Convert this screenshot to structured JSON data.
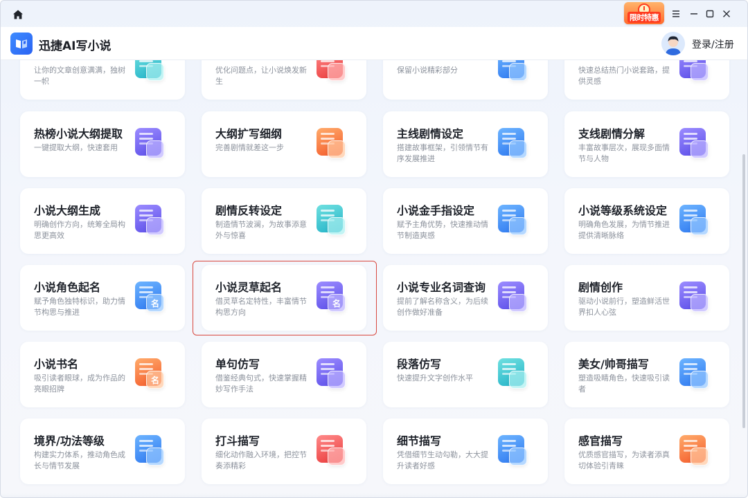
{
  "titlebar": {
    "promo_label": "限时特惠",
    "menu_icon": "hamburger-icon",
    "minimize_icon": "minimize-icon",
    "maximize_icon": "maximize-icon",
    "close_icon": "close-icon"
  },
  "header": {
    "app_title": "迅捷AI写小说",
    "login_label": "登录/注册"
  },
  "colors": {
    "blue": "#2d78f0",
    "purple": "#5a4de8",
    "orange": "#f45a2a",
    "teal": "#23b3c8",
    "red": "#ea3a3a",
    "highlight_border": "#d8473e"
  },
  "cards": [
    {
      "title": "",
      "desc": "让你的文章创意满满，独树一帜",
      "icon": "lightbulb-icon",
      "color": "teal"
    },
    {
      "title": "",
      "desc": "优化问题点，让小说焕发新生",
      "icon": "checklist-icon",
      "color": "red"
    },
    {
      "title": "",
      "desc": "保留小说精彩部分",
      "icon": "compress-icon",
      "color": "blue"
    },
    {
      "title": "",
      "desc": "快速总结热门小说套路，提供灵感",
      "icon": "layers-icon",
      "color": "purple"
    },
    {
      "title": "热榜小说大纲提取",
      "desc": "一键提取大纲，快速套用",
      "icon": "flame-layers-icon",
      "color": "purple"
    },
    {
      "title": "大纲扩写细纲",
      "desc": "完善剧情就差这一步",
      "icon": "expand-list-icon",
      "color": "orange"
    },
    {
      "title": "主线剧情设定",
      "desc": "搭建故事框架，引领情节有序发展推进",
      "icon": "gear-doc-icon",
      "color": "blue"
    },
    {
      "title": "支线剧情分解",
      "desc": "丰富故事层次，展现多面情节与人物",
      "icon": "headphone-doc-icon",
      "color": "purple"
    },
    {
      "title": "小说大纲生成",
      "desc": "明确创作方向，统筹全局构思更高效",
      "icon": "refresh-doc-icon",
      "color": "purple"
    },
    {
      "title": "剧情反转设定",
      "desc": "制造情节波澜，为故事添意外与惊喜",
      "icon": "branch-doc-icon",
      "color": "teal"
    },
    {
      "title": "小说金手指设定",
      "desc": "赋予主角优势，快速推动情节制造爽感",
      "icon": "pointer-book-icon",
      "color": "blue"
    },
    {
      "title": "小说等级系统设定",
      "desc": "明确角色发展，为情节推进提供清晰脉络",
      "icon": "star-gear-icon",
      "color": "blue"
    },
    {
      "title": "小说角色起名",
      "desc": "赋予角色独特标识，助力情节构思与推进",
      "icon": "mask-name-icon",
      "color": "blue"
    },
    {
      "title": "小说灵草起名",
      "desc": "借灵草名定特性，丰富情节构思方向",
      "icon": "leaf-name-icon",
      "color": "purple"
    },
    {
      "title": "小说专业名词查询",
      "desc": "提前了解名称含义，为后续创作做好准备",
      "icon": "search-book-icon",
      "color": "purple"
    },
    {
      "title": "剧情创作",
      "desc": "驱动小说前行，塑造鲜活世界扣人心弦",
      "icon": "feather-doc-icon",
      "color": "purple"
    },
    {
      "title": "小说书名",
      "desc": "吸引读者眼球，成为作品的亮眼招牌",
      "icon": "book-name-icon",
      "color": "orange"
    },
    {
      "title": "单句仿写",
      "desc": "借鉴经典句式，快速掌握精妙写作手法",
      "icon": "edit-doc-icon",
      "color": "purple"
    },
    {
      "title": "段落仿写",
      "desc": "快速提升文字创作水平",
      "icon": "edit-paragraph-icon",
      "color": "teal"
    },
    {
      "title": "美女/帅哥描写",
      "desc": "塑造吸睛角色，快速吸引读者",
      "icon": "face-edit-icon",
      "color": "blue"
    },
    {
      "title": "境界/功法等级",
      "desc": "构建实力体系，推动角色成长与情节发展",
      "icon": "meditate-chart-icon",
      "color": "blue"
    },
    {
      "title": "打斗描写",
      "desc": "细化动作融入环境，把控节奏添精彩",
      "icon": "fist-edit-icon",
      "color": "red"
    },
    {
      "title": "细节描写",
      "desc": "凭借细节生动勾勒，大大提升读者好感",
      "icon": "atom-edit-icon",
      "color": "blue"
    },
    {
      "title": "感官描写",
      "desc": "优质感官描写，为读者添真切体验引青睐",
      "icon": "lips-edit-icon",
      "color": "orange"
    }
  ]
}
